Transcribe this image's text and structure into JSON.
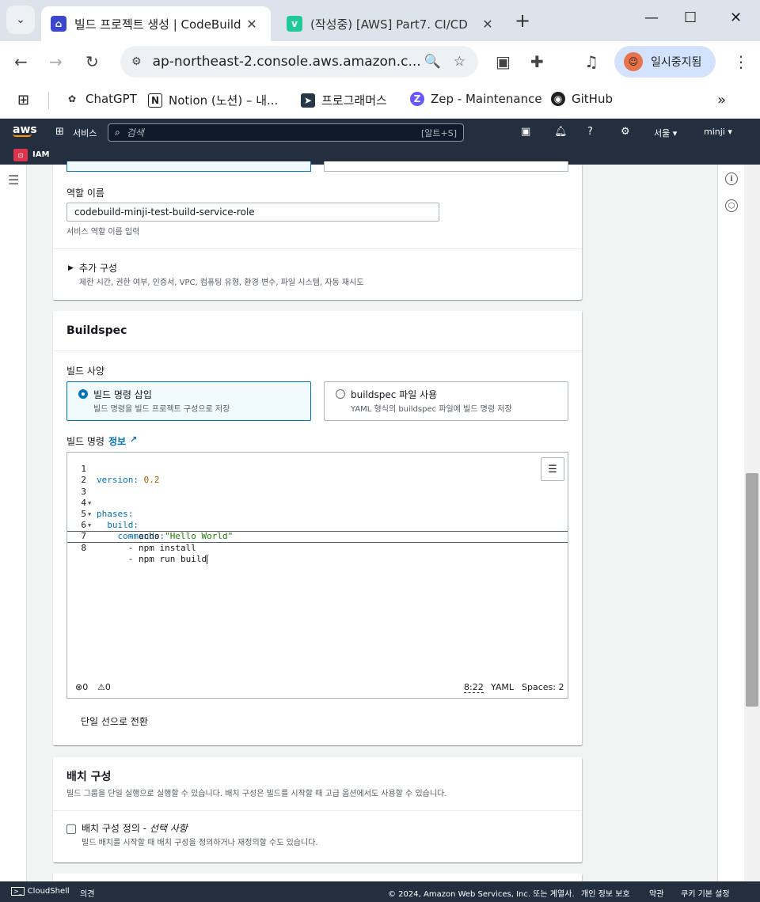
{
  "browser": {
    "tabs": [
      {
        "title": "빌드 프로젝트 생성 | CodeBuild",
        "close": "✕"
      },
      {
        "title": "(작성중) [AWS] Part7. CI/CD",
        "close": "✕"
      }
    ],
    "url": "ap-northeast-2.console.aws.amazon.c...",
    "profile_label": "일시중지됨",
    "bookmarks": [
      "ChatGPT",
      "Notion (노션) – 내...",
      "프로그래머스",
      "Zep - Maintenance",
      "GitHub"
    ]
  },
  "aws_nav": {
    "logo": "aws",
    "services_label": "서비스",
    "search_placeholder": "검색",
    "search_shortcut": "[알트+S]",
    "region": "서울 ▾",
    "user": "minji ▾",
    "favorite_service": "IAM"
  },
  "role_section": {
    "role_name_label": "역할 이름",
    "role_name_value": "codebuild-minji-test-build-service-role",
    "role_name_desc": "서비스 역할 이름 입력",
    "additional_config_title": "추가 구성",
    "additional_config_desc": "제한 시간, 권한 여부, 인증서, VPC, 컴퓨팅 유형, 환경 변수, 파일 시스템, 자동 재시도"
  },
  "buildspec": {
    "heading": "Buildspec",
    "spec_label": "빌드 사양",
    "options": [
      {
        "title": "빌드 명령 삽입",
        "desc": "빌드 명령을 빌드 프로젝트 구성으로 저장",
        "selected": true
      },
      {
        "title": "buildspec 파일 사용",
        "desc": "YAML 형식의 buildspec 파일에 빌드 명령 저장",
        "selected": false
      }
    ],
    "commands_label": "빌드 명령",
    "info_link": "정보",
    "code_lines": [
      {
        "n": "1",
        "text": "version: 0.2"
      },
      {
        "n": "2",
        "text": ""
      },
      {
        "n": "3",
        "text": "phases:"
      },
      {
        "n": "4",
        "text": "  build:"
      },
      {
        "n": "5",
        "text": "    commands:"
      },
      {
        "n": "6",
        "text": "      - echo \"Hello World\""
      },
      {
        "n": "7",
        "text": "      - npm install"
      },
      {
        "n": "8",
        "text": "      - npm run build"
      }
    ],
    "code_tokens": {
      "version_key": "version:",
      "version_val": "0.2",
      "phases_key": "phases:",
      "build_key": "build:",
      "commands_key": "commands:",
      "echo_cmd": "- echo ",
      "echo_str": "\"Hello World\"",
      "npm_install": "- npm install",
      "npm_build": "- npm run build"
    },
    "status": {
      "errors": "0",
      "warnings": "0",
      "cursor_pos": "8:22",
      "language": "YAML",
      "spaces": "Spaces: 2"
    },
    "switch_link": "단일 선으로 전환"
  },
  "batch": {
    "heading": "배치 구성",
    "desc": "빌드 그룹을 단일 실행으로 실행할 수 있습니다. 배치 구성은 빌드를 시작할 때 고급 옵션에서도 사용할 수 있습니다.",
    "checkbox_label": "배치 구성 정의 - ",
    "checkbox_optional": "선택 사항",
    "checkbox_desc": "빌드 배치를 시작할 때 배치 구성을 정의하거나 재정의할 수도 있습니다."
  },
  "footer": {
    "cloudshell": "CloudShell",
    "feedback": "의견",
    "copyright": "© 2024, Amazon Web Services, Inc. 또는 계열사.",
    "privacy": "개인 정보 보호",
    "terms": "약관",
    "cookies": "쿠키 기본 설정"
  }
}
